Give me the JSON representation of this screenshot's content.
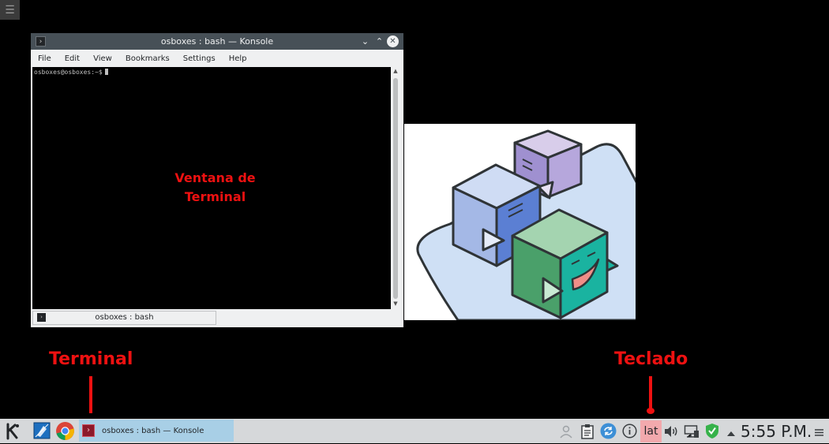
{
  "desktop": {
    "toolbox_icon": "desktop-toolbox-icon"
  },
  "window": {
    "title": "osboxes : bash — Konsole",
    "menu": [
      "File",
      "Edit",
      "View",
      "Bookmarks",
      "Settings",
      "Help"
    ],
    "prompt": "osboxes@osboxes:~$",
    "tab_label": "osboxes : bash"
  },
  "annotations": {
    "window_label": "Ventana de\nTerminal",
    "terminal_label": "Terminal",
    "keyboard_label": "Teclado",
    "color": "#ee1111"
  },
  "taskbar": {
    "task_label": "osboxes : bash — Konsole",
    "keyboard_layout": "lat",
    "clock": "5:55 P.M.",
    "launchers": [
      "kde-menu-icon",
      "kate-icon",
      "chrome-icon",
      "konsole-icon"
    ],
    "tray_icons": [
      "user-icon",
      "clipboard-icon",
      "updates-icon",
      "info-icon",
      "volume-icon",
      "network-icon",
      "shield-icon",
      "expand-arrow-icon",
      "menu-icon"
    ]
  },
  "colors": {
    "titlebar": "#475057",
    "taskbar": "#d6d8da",
    "task_active": "#a8cfe6",
    "keyboard_highlight": "#f2a9ad"
  }
}
